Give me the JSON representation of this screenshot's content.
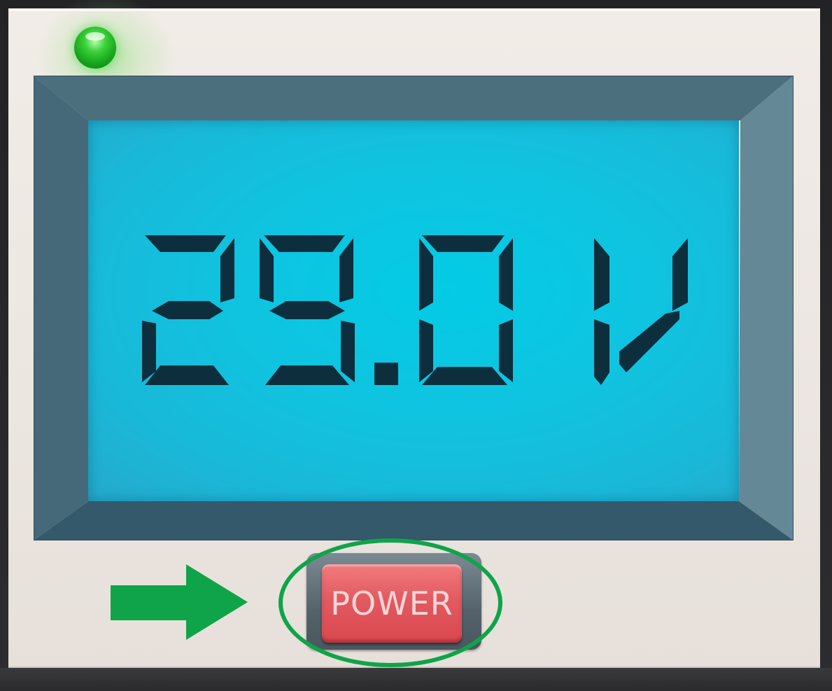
{
  "meter": {
    "reading": "29.0V",
    "digits": [
      "2",
      "9",
      "0",
      "V"
    ],
    "has_decimal_point": true,
    "status_led": "on"
  },
  "controls": {
    "power_label": "POWER"
  },
  "icons": {
    "status_led": "status-led-icon",
    "pointer_arrow": "arrow-right-icon"
  },
  "colors": {
    "led_green": "#22c12a",
    "lcd_background": "#03cbe6",
    "lcd_segments": "#0d2f3d",
    "bezel": "#4a6e7c",
    "power_button": "#e25a60",
    "highlight": "#0fa44a"
  }
}
